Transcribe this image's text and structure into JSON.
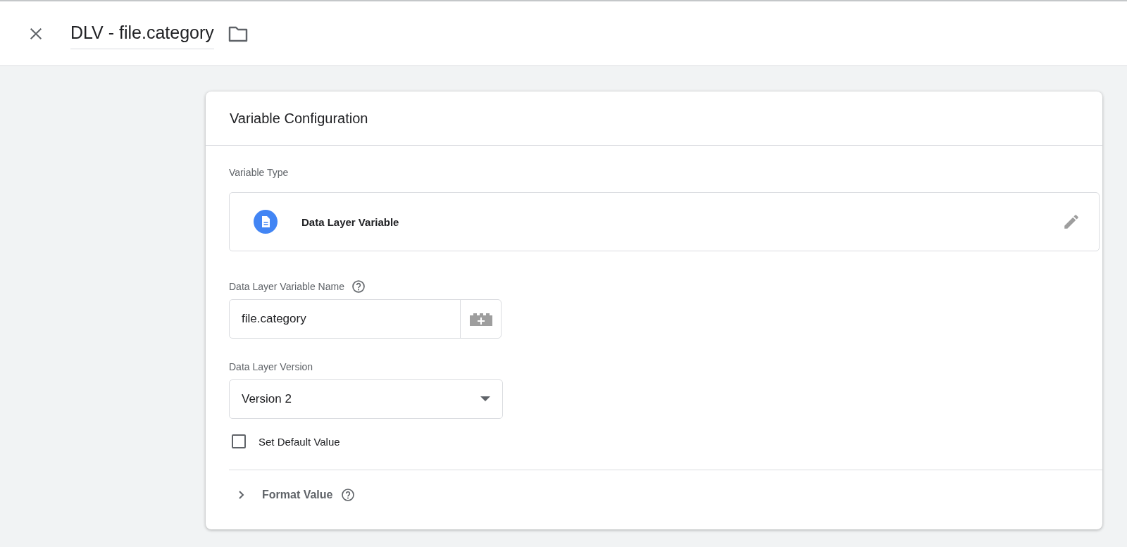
{
  "header": {
    "title": "DLV - file.category"
  },
  "card": {
    "title": "Variable Configuration",
    "variable_type": {
      "label": "Variable Type",
      "name": "Data Layer Variable"
    },
    "variable_name": {
      "label": "Data Layer Variable Name",
      "value": "file.category"
    },
    "version": {
      "label": "Data Layer Version",
      "value": "Version 2"
    },
    "default_value": {
      "label": "Set Default Value",
      "checked": false
    },
    "format_value": {
      "label": "Format Value",
      "expanded": false
    }
  }
}
